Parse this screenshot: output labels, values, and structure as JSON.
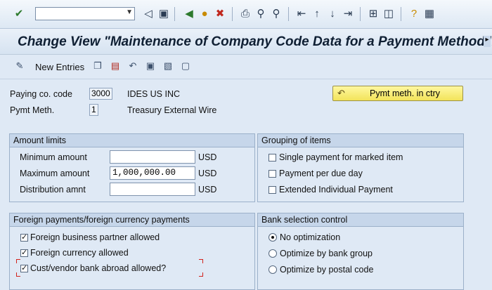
{
  "command_field": {
    "value": ""
  },
  "toolbar_icons": [
    "check-icon",
    "back-triangle-icon",
    "save-icon",
    "back-icon",
    "exit-icon",
    "cancel-icon",
    "print-icon",
    "find-icon",
    "find-next-icon",
    "first-page-icon",
    "previous-page-icon",
    "next-page-icon",
    "last-page-icon",
    "layout-icon",
    "create-session-icon",
    "help-icon",
    "customize-icon"
  ],
  "title": "Change View \"Maintenance of Company Code Data for a Payment Method\": ",
  "app_toolbar": {
    "new_entries_label": "New Entries",
    "icons": [
      "edit-icon",
      "copy-icon",
      "delete-icon",
      "undo-icon",
      "select-all-icon",
      "select-block-icon",
      "deselect-icon"
    ]
  },
  "header": {
    "paying_co_code_label": "Paying co. code",
    "paying_co_code_value": "3000",
    "paying_co_code_text": "IDES US INC",
    "pymt_meth_label": "Pymt Meth.",
    "pymt_meth_value": "1",
    "pymt_meth_text": "Treasury External Wire",
    "pymt_meth_ctry_button": "Pymt meth. in ctry"
  },
  "amount_limits": {
    "title": "Amount limits",
    "rows": [
      {
        "label": "Minimum amount",
        "value": "",
        "currency": "USD"
      },
      {
        "label": "Maximum amount",
        "value": "1,000,000.00",
        "currency": "USD"
      },
      {
        "label": "Distribution amnt",
        "value": "",
        "currency": "USD"
      }
    ]
  },
  "grouping": {
    "title": "Grouping of items",
    "items": [
      {
        "label": "Single payment for marked item",
        "checked": false
      },
      {
        "label": "Payment per due day",
        "checked": false
      },
      {
        "label": "Extended Individual Payment",
        "checked": false
      }
    ]
  },
  "foreign": {
    "title": "Foreign payments/foreign currency payments",
    "items": [
      {
        "label": "Foreign business partner allowed",
        "checked": true
      },
      {
        "label": "Foreign currency allowed",
        "checked": true
      },
      {
        "label": "Cust/vendor bank abroad allowed?",
        "checked": true
      }
    ]
  },
  "bank_selection": {
    "title": "Bank selection control",
    "options": [
      {
        "label": "No optimization",
        "selected": true
      },
      {
        "label": "Optimize by bank group",
        "selected": false
      },
      {
        "label": "Optimize by postal code",
        "selected": false
      }
    ]
  },
  "colors": {
    "accent": "#f2e35a",
    "highlight": "#d2231c"
  }
}
